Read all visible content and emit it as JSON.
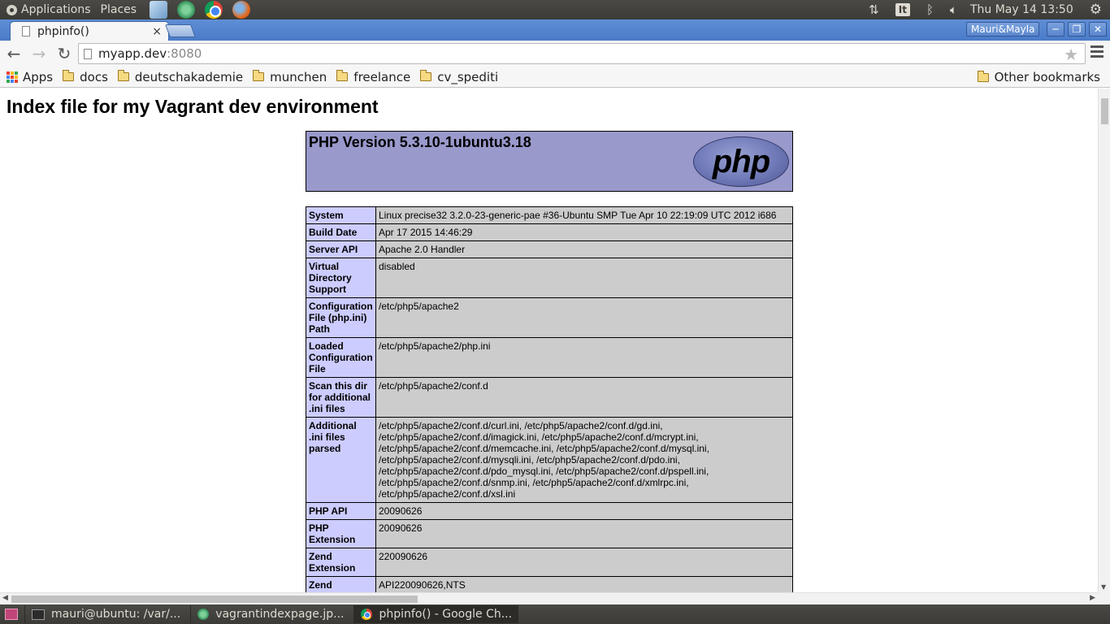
{
  "top_panel": {
    "applications_label": "Applications",
    "places_label": "Places",
    "keyboard_layout": "It",
    "clock": "Thu May 14 13:50"
  },
  "browser": {
    "tab_title": "phpinfo()",
    "tab_close": "×",
    "profile_name": "Mauri&Mayla",
    "url_host": "myapp.dev",
    "url_port": ":8080",
    "bookmarks": [
      "docs",
      "deutschakademie",
      "munchen",
      "freelance",
      "cv_spediti"
    ],
    "apps_label": "Apps",
    "other_bookmarks_label": "Other bookmarks"
  },
  "page": {
    "heading": "Index file for my Vagrant dev environment",
    "php_version": "PHP Version 5.3.10-1ubuntu3.18",
    "php_logo_text": "php",
    "rows": [
      {
        "key": "System",
        "value": "Linux precise32 3.2.0-23-generic-pae #36-Ubuntu SMP Tue Apr 10 22:19:09 UTC 2012 i686"
      },
      {
        "key": "Build Date",
        "value": "Apr 17 2015 14:46:29"
      },
      {
        "key": "Server API",
        "value": "Apache 2.0 Handler"
      },
      {
        "key": "Virtual Directory Support",
        "value": "disabled"
      },
      {
        "key": "Configuration File (php.ini) Path",
        "value": "/etc/php5/apache2"
      },
      {
        "key": "Loaded Configuration File",
        "value": "/etc/php5/apache2/php.ini"
      },
      {
        "key": "Scan this dir for additional .ini files",
        "value": "/etc/php5/apache2/conf.d"
      },
      {
        "key": "Additional .ini files parsed",
        "value": "/etc/php5/apache2/conf.d/curl.ini, /etc/php5/apache2/conf.d/gd.ini, /etc/php5/apache2/conf.d/imagick.ini, /etc/php5/apache2/conf.d/mcrypt.ini, /etc/php5/apache2/conf.d/memcache.ini, /etc/php5/apache2/conf.d/mysql.ini, /etc/php5/apache2/conf.d/mysqli.ini, /etc/php5/apache2/conf.d/pdo.ini, /etc/php5/apache2/conf.d/pdo_mysql.ini, /etc/php5/apache2/conf.d/pspell.ini, /etc/php5/apache2/conf.d/snmp.ini, /etc/php5/apache2/conf.d/xmlrpc.ini, /etc/php5/apache2/conf.d/xsl.ini"
      },
      {
        "key": "PHP API",
        "value": "20090626"
      },
      {
        "key": "PHP Extension",
        "value": "20090626"
      },
      {
        "key": "Zend Extension",
        "value": "220090626"
      },
      {
        "key": "Zend",
        "value": "API220090626,NTS"
      }
    ]
  },
  "taskbar": {
    "tasks": [
      {
        "label": "mauri@ubuntu: /var/...",
        "icon": "terminal-icon"
      },
      {
        "label": "vagrantindexpage.jp...",
        "icon": "image-viewer-icon"
      },
      {
        "label": "phpinfo() - Google Ch...",
        "icon": "chrome-icon"
      }
    ]
  },
  "colors": {
    "php_header_bg": "#9999cc",
    "php_key_bg": "#ccccff",
    "php_value_bg": "#cccccc",
    "tabstrip_blue": "#4a7bc8",
    "panel_dark": "#3c3b37"
  }
}
